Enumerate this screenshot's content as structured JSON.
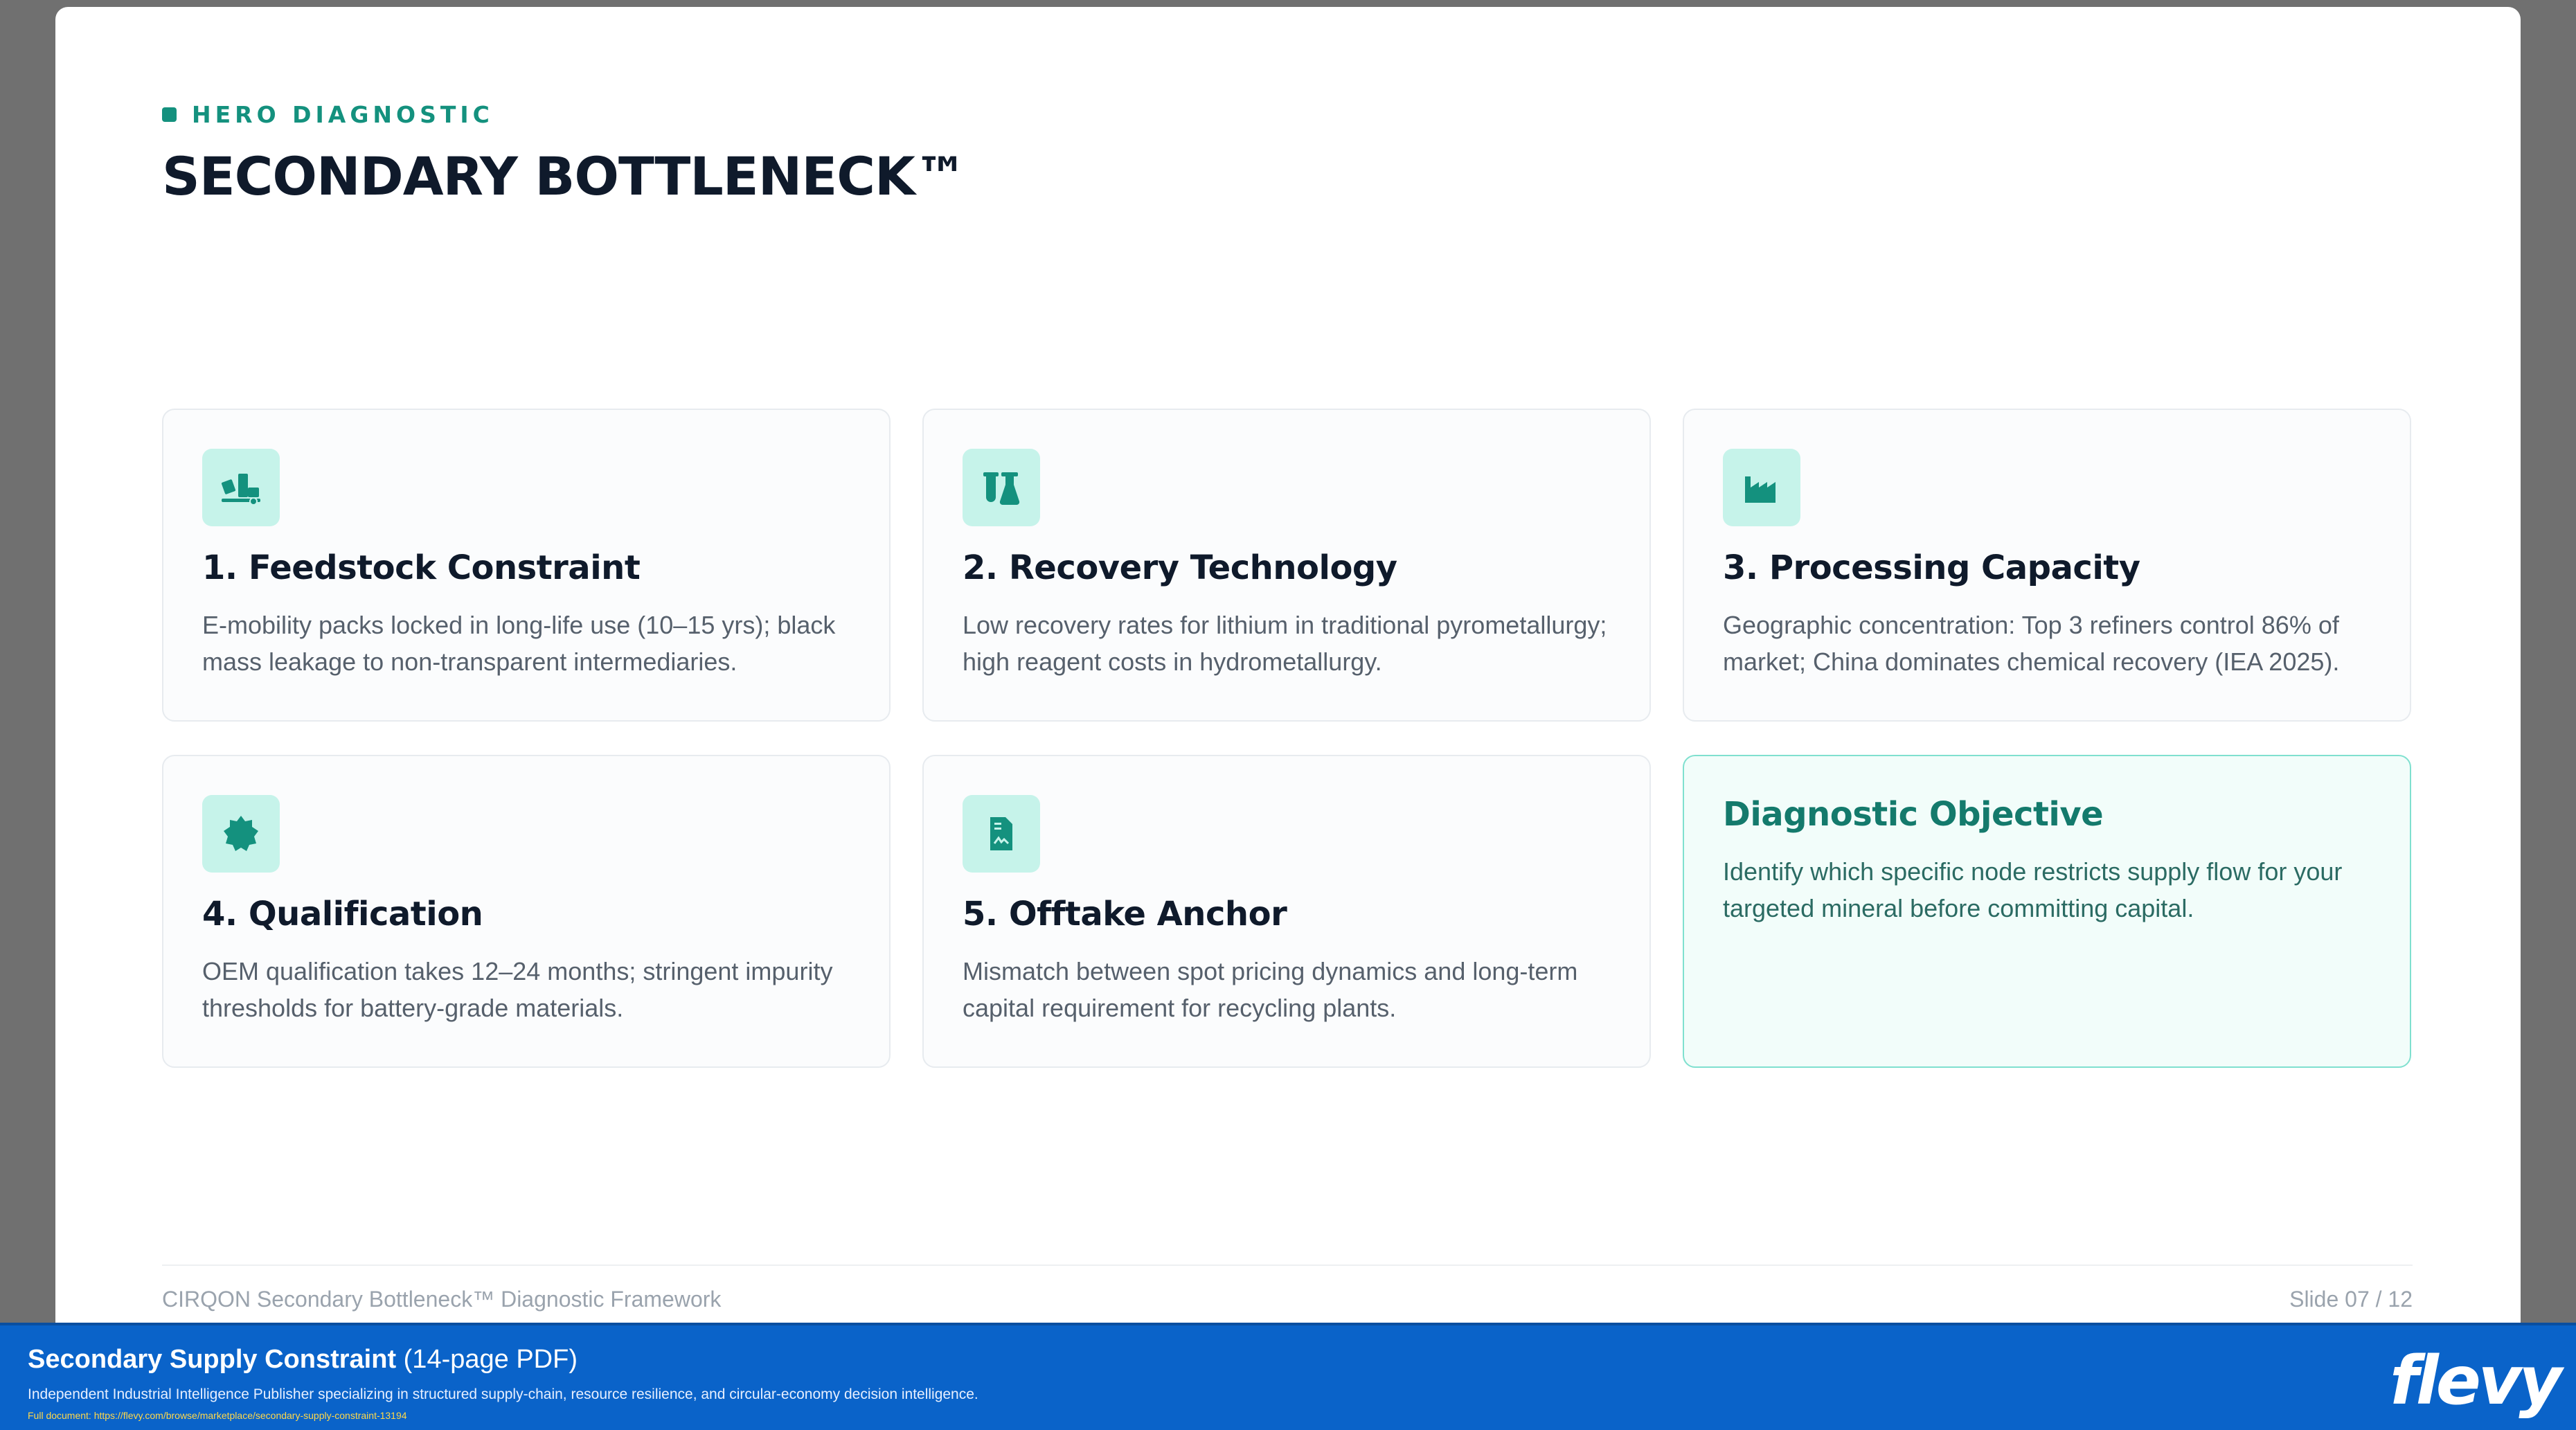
{
  "slide": {
    "eyebrow": "HERO DIAGNOSTIC",
    "title": "SECONDARY BOTTLENECK™",
    "cards": [
      {
        "icon": "truck-loading-icon",
        "title": "1. Feedstock Constraint",
        "body": "E-mobility packs locked in long-life use (10–15 yrs); black mass leakage to non-transparent intermediaries."
      },
      {
        "icon": "flask-vial-icon",
        "title": "2. Recovery Technology",
        "body": "Low recovery rates for lithium in traditional pyrometallurgy; high reagent costs in hydrometallurgy."
      },
      {
        "icon": "industry-icon",
        "title": "3. Processing Capacity",
        "body": "Geographic concentration: Top 3 refiners control 86% of market; China dominates chemical recovery (IEA 2025)."
      },
      {
        "icon": "certificate-icon",
        "title": "4. Qualification",
        "body": "OEM qualification takes 12–24 months; stringent impurity thresholds for battery-grade materials."
      },
      {
        "icon": "contract-icon",
        "title": "5. Offtake Anchor",
        "body": "Mismatch between spot pricing dynamics and long-term capital requirement for recycling plants."
      }
    ],
    "objective": {
      "title": "Diagnostic Objective",
      "body": "Identify which specific node restricts supply flow for your targeted mineral before committing capital."
    },
    "footer_left": "CIRQON Secondary Bottleneck™ Diagnostic Framework",
    "footer_right": "Slide 07 / 12"
  },
  "banner": {
    "title": "Secondary Supply Constraint",
    "pages": "(14-page PDF)",
    "subtitle": "Independent Industrial Intelligence Publisher specializing in structured supply-chain, resource resilience, and circular-economy decision intelligence.",
    "url": "Full document: https://flevy.com/browse/marketplace/secondary-supply-constraint-13194",
    "logo": "flevy"
  },
  "colors": {
    "accent": "#14917e",
    "icon_bg": "#c6f3ea",
    "banner": "#0a63c9"
  }
}
